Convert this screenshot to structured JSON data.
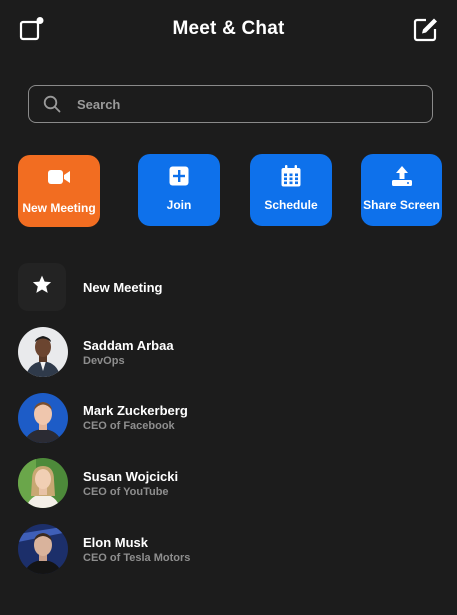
{
  "header": {
    "title": "Meet & Chat",
    "left_icon": "new-window-icon",
    "right_icon": "compose-icon"
  },
  "search": {
    "placeholder": "Search",
    "value": ""
  },
  "actions": [
    {
      "label": "New Meeting",
      "icon": "video-camera-icon",
      "color": "#f26d21"
    },
    {
      "label": "Join",
      "icon": "plus-square-icon",
      "color": "#0e71eb"
    },
    {
      "label": "Schedule",
      "icon": "calendar-icon",
      "color": "#0e71eb"
    },
    {
      "label": "Share Screen",
      "icon": "upload-icon",
      "color": "#0e71eb"
    }
  ],
  "list": {
    "new_meeting": {
      "label": "New Meeting",
      "icon": "star-icon"
    },
    "contacts": [
      {
        "name": "Saddam Arbaa",
        "role": "DevOps"
      },
      {
        "name": "Mark Zuckerberg",
        "role": "CEO of Facebook"
      },
      {
        "name": "Susan Wojcicki",
        "role": "CEO of YouTube"
      },
      {
        "name": "Elon Musk",
        "role": "CEO of Tesla Motors"
      }
    ]
  },
  "colors": {
    "background": "#1c1c1c",
    "accent_blue": "#0e71eb",
    "accent_orange": "#f26d21",
    "subtext": "#8e8e8e"
  }
}
